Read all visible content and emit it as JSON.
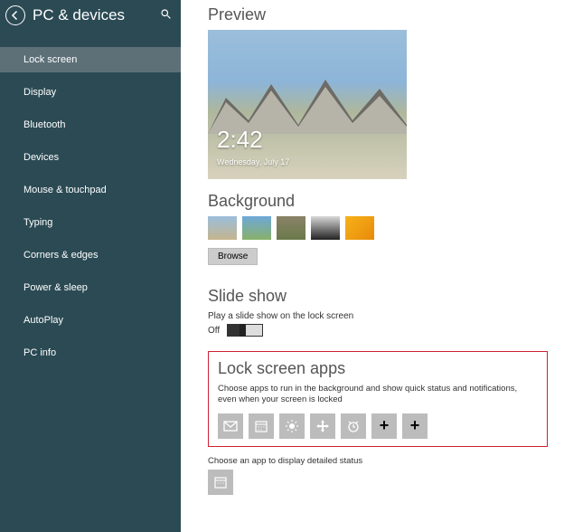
{
  "header": {
    "title": "PC & devices"
  },
  "sidebar": {
    "items": [
      {
        "label": "Lock screen",
        "selected": true
      },
      {
        "label": "Display"
      },
      {
        "label": "Bluetooth"
      },
      {
        "label": "Devices"
      },
      {
        "label": "Mouse & touchpad"
      },
      {
        "label": "Typing"
      },
      {
        "label": "Corners & edges"
      },
      {
        "label": "Power & sleep"
      },
      {
        "label": "AutoPlay"
      },
      {
        "label": "PC info"
      }
    ]
  },
  "preview": {
    "heading": "Preview",
    "time": "2:42",
    "date": "Wednesday, July 17"
  },
  "background": {
    "heading": "Background",
    "browse_label": "Browse"
  },
  "slideshow": {
    "heading": "Slide show",
    "label": "Play a slide show on the lock screen",
    "state": "Off"
  },
  "lockscreen_apps": {
    "heading": "Lock screen apps",
    "description": "Choose apps to run in the background and show quick status and notifications, even when your screen is locked"
  },
  "detailed_status": {
    "label": "Choose an app to display detailed status"
  }
}
